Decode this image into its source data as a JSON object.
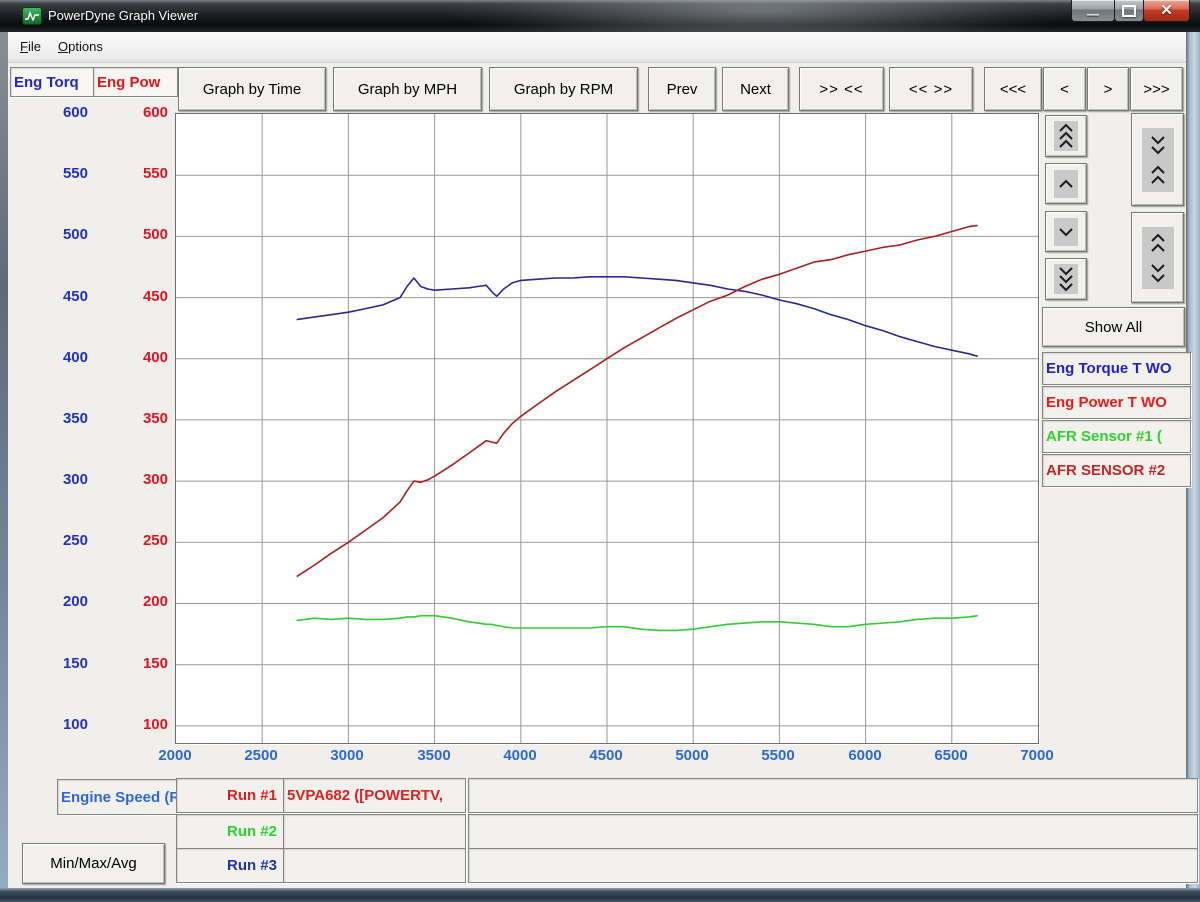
{
  "window": {
    "title": "PowerDyne Graph Viewer"
  },
  "menu": {
    "file": {
      "initial": "F",
      "rest": "ile"
    },
    "options": {
      "initial": "O",
      "rest": "ptions"
    }
  },
  "toolbar": {
    "torque_tab": "Eng Torq",
    "power_tab": "Eng Pow",
    "graph_by_time": "Graph by Time",
    "graph_by_mph": "Graph by MPH",
    "graph_by_rpm": "Graph by RPM",
    "prev": "Prev",
    "next": "Next",
    "zoom_in": ">> <<",
    "zoom_out": "<< >>",
    "fast_left": "<<<",
    "step_left": "<",
    "step_right": ">",
    "fast_right": ">>>"
  },
  "right_panel": {
    "show_all": "Show All",
    "legend": [
      {
        "label": "Eng Torque T WO",
        "color": "#2222cc"
      },
      {
        "label": "Eng Power T WO",
        "color": "#ee1a1a"
      },
      {
        "label": "AFR Sensor #1 (",
        "color": "#2ed32e"
      },
      {
        "label": "AFR SENSOR #2",
        "color": "#c22828"
      }
    ],
    "icons": [
      "chevrons-up",
      "chevron-up",
      "chevron-down",
      "chevrons-down",
      "chevrons-compress-vertical",
      "chevrons-expand-vertical"
    ]
  },
  "bottom_panel": {
    "x_axis_field": "Engine Speed (R",
    "min_max_avg": "Min/Max/Avg",
    "runs": [
      {
        "label": "Run #1",
        "color": "#e02020",
        "value": "5VPA682 ([POWERTV,",
        "extra": ""
      },
      {
        "label": "Run #2",
        "color": "#2ed32e",
        "value": "",
        "extra": ""
      },
      {
        "label": "Run #3",
        "color": "#2233b0",
        "value": "",
        "extra": ""
      }
    ]
  },
  "chart_data": {
    "type": "line",
    "xlim": [
      2000,
      7000
    ],
    "ylim_left": [
      100,
      600
    ],
    "ylim_right": [
      100,
      600
    ],
    "x_ticks": [
      2000,
      2500,
      3000,
      3500,
      4000,
      4500,
      5000,
      5500,
      6000,
      6500,
      7000
    ],
    "y_ticks": [
      600,
      550,
      500,
      450,
      400,
      350,
      300,
      250,
      200,
      150,
      100
    ],
    "grid": true,
    "x": [
      2700,
      2800,
      2900,
      3000,
      3100,
      3200,
      3300,
      3340,
      3380,
      3420,
      3460,
      3500,
      3600,
      3700,
      3750,
      3800,
      3830,
      3860,
      3900,
      3950,
      4000,
      4100,
      4200,
      4300,
      4400,
      4500,
      4600,
      4700,
      4800,
      4900,
      5000,
      5100,
      5200,
      5300,
      5400,
      5500,
      5600,
      5700,
      5800,
      5900,
      6000,
      6100,
      6200,
      6300,
      6400,
      6500,
      6600,
      6650
    ],
    "series": [
      {
        "name": "Eng Torque T WO",
        "axis": "left",
        "color": "#28289a",
        "values": [
          432,
          434,
          436,
          438,
          441,
          444,
          450,
          459,
          466,
          459,
          457,
          456,
          457,
          458,
          459,
          460,
          455,
          451,
          457,
          462,
          464,
          465,
          466,
          466,
          467,
          467,
          467,
          466,
          465,
          464,
          462,
          460,
          457,
          455,
          452,
          448,
          445,
          441,
          436,
          432,
          427,
          423,
          418,
          414,
          410,
          407,
          404,
          402
        ]
      },
      {
        "name": "Eng Power T WO",
        "axis": "right",
        "color": "#aa1f1f",
        "values": [
          222,
          231,
          241,
          250,
          260,
          270,
          283,
          292,
          300,
          299,
          301,
          304,
          313,
          323,
          328,
          333,
          332,
          331,
          339,
          347,
          353,
          363,
          373,
          382,
          391,
          400,
          409,
          417,
          425,
          433,
          440,
          447,
          452,
          459,
          465,
          469,
          474,
          479,
          481,
          485,
          488,
          491,
          493,
          497,
          500,
          504,
          508,
          509
        ]
      },
      {
        "name": "AFR Sensor #1 (",
        "axis": "left",
        "color": "#33cc33",
        "values": [
          186,
          188,
          187,
          188,
          187,
          187,
          188,
          189,
          189,
          190,
          190,
          190,
          188,
          185,
          184,
          183,
          183,
          182,
          181,
          180,
          180,
          180,
          180,
          180,
          180,
          181,
          181,
          179,
          178,
          178,
          179,
          181,
          183,
          184,
          185,
          185,
          184,
          183,
          181,
          181,
          183,
          184,
          185,
          187,
          188,
          188,
          189,
          190
        ]
      }
    ]
  }
}
